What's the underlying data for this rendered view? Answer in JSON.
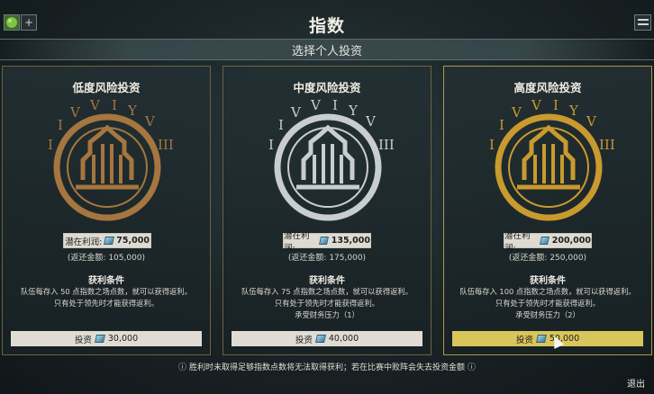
{
  "header": {
    "title": "指数",
    "subtitle": "选择个人投资",
    "left_button_plus": "+"
  },
  "cards": [
    {
      "title": "低度风险投资",
      "profit_label": "潜在利润:",
      "profit_value": "75,000",
      "refund": "(返还金额: 105,000)",
      "conditions_title": "获利条件",
      "conditions": [
        "队伍每存入 50 点指数之场点数，就可以获得返利。",
        "只有处于领先时才能获得返利。"
      ],
      "invest_label": "投资",
      "invest_value": "30,000",
      "emblem_color": "bronze"
    },
    {
      "title": "中度风险投资",
      "profit_label": "潜在利润:",
      "profit_value": "135,000",
      "refund": "(返还金额: 175,000)",
      "conditions_title": "获利条件",
      "conditions": [
        "队伍每存入 75 点指数之场点数，就可以获得返利。",
        "只有处于领先时才能获得返利。",
        "承受财务压力（1）"
      ],
      "invest_label": "投资",
      "invest_value": "40,000",
      "emblem_color": "silver"
    },
    {
      "title": "高度风险投资",
      "profit_label": "潜在利润:",
      "profit_value": "200,000",
      "refund": "(返还金额: 250,000)",
      "conditions_title": "获利条件",
      "conditions": [
        "队伍每存入 100 点指数之场点数，就可以获得返利。",
        "只有处于领先时才能获得返利。",
        "承受财务压力（2）"
      ],
      "invest_label": "投资",
      "invest_value": "50,000",
      "emblem_color": "gold"
    }
  ],
  "footer": {
    "note": "ⓘ 胜利时未取得足够指数点数将无法取得获利；若在比赛中败阵会失去投资金额 ⓘ",
    "exit_label": "退出"
  },
  "colors": {
    "bronze": "#a5763f",
    "silver": "#c9cdd0",
    "gold": "#c99a2e",
    "selected_button": "#d8c65a"
  }
}
